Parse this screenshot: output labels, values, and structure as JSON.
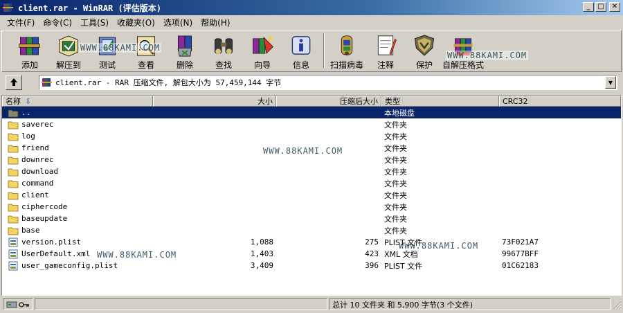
{
  "window": {
    "title": "client.rar - WinRAR (评估版本)",
    "minimize_glyph": "_",
    "maximize_glyph": "□",
    "close_glyph": "✕"
  },
  "menu": [
    {
      "label": "文件(F)"
    },
    {
      "label": "命令(C)"
    },
    {
      "label": "工具(S)"
    },
    {
      "label": "收藏夹(O)"
    },
    {
      "label": "选项(N)"
    },
    {
      "label": "帮助(H)"
    }
  ],
  "toolbar": [
    {
      "label": "添加",
      "icon": "add-books-icon"
    },
    {
      "label": "解压到",
      "icon": "extract-to-icon"
    },
    {
      "label": "测试",
      "icon": "test-icon"
    },
    {
      "label": "查看",
      "icon": "view-icon"
    },
    {
      "label": "删除",
      "icon": "delete-icon"
    },
    {
      "label": "查找",
      "icon": "find-binoculars-icon"
    },
    {
      "label": "向导",
      "icon": "wizard-icon"
    },
    {
      "label": "信息",
      "icon": "info-icon"
    },
    {
      "label": "扫描病毒",
      "icon": "virus-scan-icon"
    },
    {
      "label": "注释",
      "icon": "comment-icon"
    },
    {
      "label": "保护",
      "icon": "protect-shield-icon"
    },
    {
      "label": "自解压格式",
      "icon": "sfx-icon"
    }
  ],
  "address": {
    "text": "client.rar - RAR 压缩文件, 解包大小为 57,459,144 字节"
  },
  "columns": {
    "name": "名称",
    "size": "大小",
    "packed": "压缩后大小",
    "type": "类型",
    "crc": "CRC32"
  },
  "rows": [
    {
      "name": "..",
      "size": "",
      "packed": "",
      "type": "本地磁盘",
      "crc": "",
      "kind": "parent",
      "selected": true
    },
    {
      "name": "saverec",
      "size": "",
      "packed": "",
      "type": "文件夹",
      "crc": "",
      "kind": "folder"
    },
    {
      "name": "log",
      "size": "",
      "packed": "",
      "type": "文件夹",
      "crc": "",
      "kind": "folder"
    },
    {
      "name": "friend",
      "size": "",
      "packed": "",
      "type": "文件夹",
      "crc": "",
      "kind": "folder"
    },
    {
      "name": "downrec",
      "size": "",
      "packed": "",
      "type": "文件夹",
      "crc": "",
      "kind": "folder"
    },
    {
      "name": "download",
      "size": "",
      "packed": "",
      "type": "文件夹",
      "crc": "",
      "kind": "folder"
    },
    {
      "name": "command",
      "size": "",
      "packed": "",
      "type": "文件夹",
      "crc": "",
      "kind": "folder"
    },
    {
      "name": "client",
      "size": "",
      "packed": "",
      "type": "文件夹",
      "crc": "",
      "kind": "folder"
    },
    {
      "name": "ciphercode",
      "size": "",
      "packed": "",
      "type": "文件夹",
      "crc": "",
      "kind": "folder"
    },
    {
      "name": "baseupdate",
      "size": "",
      "packed": "",
      "type": "文件夹",
      "crc": "",
      "kind": "folder"
    },
    {
      "name": "base",
      "size": "",
      "packed": "",
      "type": "文件夹",
      "crc": "",
      "kind": "folder"
    },
    {
      "name": "version.plist",
      "size": "1,088",
      "packed": "275",
      "type": "PLIST 文件",
      "crc": "73F021A7",
      "kind": "file"
    },
    {
      "name": "UserDefault.xml",
      "size": "1,403",
      "packed": "423",
      "type": "XML 文档",
      "crc": "99677BFF",
      "kind": "file"
    },
    {
      "name": "user_gameconfig.plist",
      "size": "3,409",
      "packed": "396",
      "type": "PLIST 文件",
      "crc": "01C62183",
      "kind": "file"
    }
  ],
  "watermarks": [
    {
      "text": "WWW.88KAMI.COM"
    },
    {
      "text": "WWW.88KAMI.COM"
    },
    {
      "text": "WWW.88KAMI.COM"
    },
    {
      "text": "WWW.88KAMI.COM"
    },
    {
      "text": "WWW.88KAMI.COM"
    }
  ],
  "status": {
    "left": "",
    "right": "总计 10 文件夹 和 5,900 字节(3 个文件)"
  },
  "colors": {
    "title_start": "#0a246a",
    "title_end": "#a6caf0",
    "selection": "#0a246a",
    "folder": "#f4d35e",
    "face": "#d4d0c8"
  }
}
